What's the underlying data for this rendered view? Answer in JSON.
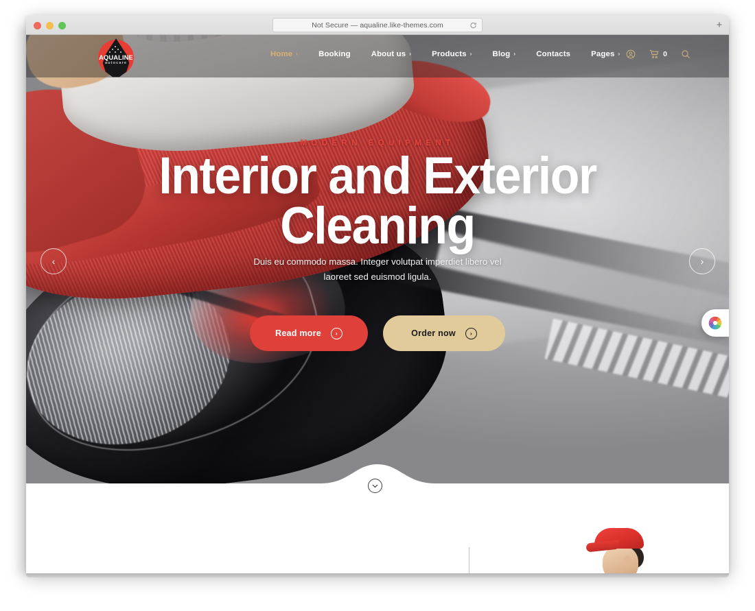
{
  "browser": {
    "url_text": "Not Secure — aqualine.like-themes.com",
    "reload_icon": "reload-icon",
    "newtab_label": "+",
    "traffic_lights": [
      "close",
      "minimize",
      "zoom"
    ]
  },
  "site": {
    "logo": {
      "name": "AQUALINE",
      "tagline": "autocare",
      "shape": "water-drop-logo"
    },
    "nav": {
      "items": [
        {
          "label": "Home",
          "has_caret": true,
          "active": true
        },
        {
          "label": "Booking",
          "has_caret": false,
          "active": false
        },
        {
          "label": "About us",
          "has_caret": true,
          "active": false
        },
        {
          "label": "Products",
          "has_caret": true,
          "active": false
        },
        {
          "label": "Blog",
          "has_caret": true,
          "active": false
        },
        {
          "label": "Contacts",
          "has_caret": false,
          "active": false
        },
        {
          "label": "Pages",
          "has_caret": true,
          "active": false
        }
      ],
      "caret": "›"
    },
    "header_icons": {
      "account": "user-account-icon",
      "cart": "shopping-cart-icon",
      "cart_count": "0",
      "search": "search-icon"
    },
    "hero": {
      "eyebrow": "MODERN EQUIPMENT",
      "headline_line1": "Interior and Exterior",
      "headline_line2": "Cleaning",
      "subtitle": "Duis eu commodo massa. Integer volutpat imperdiet libero vel laoreet sed euismod ligula.",
      "primary_button": "Read more",
      "secondary_button": "Order now",
      "arrow_glyph": "›",
      "prev_arrow": "‹",
      "next_arrow": "›",
      "scroll_chevron": "⌄",
      "image_alt": "gloved hand wiping car headlight with red microfiber towel"
    },
    "theme_widget": "color-wheel-icon",
    "next_section": {
      "image_alt": "worker wearing red cap"
    }
  },
  "colors": {
    "accent_red": "#e0403a",
    "accent_gold": "#d9b273",
    "button_tan": "#e2cb9b",
    "eyebrow_red": "#e8443c",
    "header_overlay": "rgba(35,35,38,0.42)",
    "text_white": "#ffffff"
  }
}
